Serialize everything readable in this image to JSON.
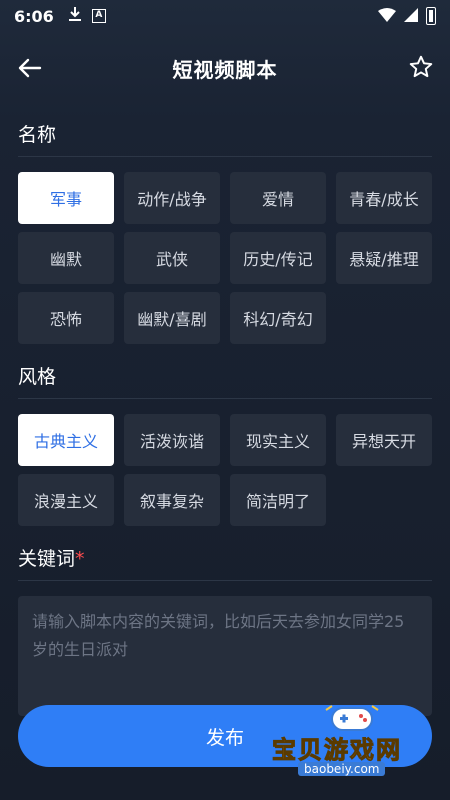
{
  "status_bar": {
    "time": "6:06",
    "icons": [
      "download-icon",
      "a-badge-icon",
      "wifi-icon",
      "signal-icon",
      "battery-icon"
    ],
    "badge_text": "A"
  },
  "header": {
    "title": "短视频脚本",
    "back_icon": "arrow-left-icon",
    "star_icon": "star-outline-icon"
  },
  "name_section": {
    "label": "名称",
    "options": [
      "军事",
      "动作/战争",
      "爱情",
      "青春/成长",
      "幽默",
      "武侠",
      "历史/传记",
      "悬疑/推理",
      "恐怖",
      "幽默/喜剧",
      "科幻/奇幻"
    ],
    "selected": "军事"
  },
  "style_section": {
    "label": "风格",
    "options": [
      "古典主义",
      "活泼诙谐",
      "现实主义",
      "异想天开",
      "浪漫主义",
      "叙事复杂",
      "简洁明了"
    ],
    "selected": "古典主义"
  },
  "keyword_section": {
    "label": "关键词",
    "required_mark": "*",
    "placeholder": "请输入脚本内容的关键词，比如后天去参加女同学25岁的生日派对"
  },
  "publish": {
    "label": "发布"
  },
  "watermark": {
    "name": "宝贝游戏网",
    "domain": "baobeiy.com"
  },
  "colors": {
    "accent": "#2f7ef6",
    "selected_text": "#2f6fe4",
    "chip_bg": "#262e3c",
    "background": "#161d2a",
    "required": "#ff4d4f"
  }
}
